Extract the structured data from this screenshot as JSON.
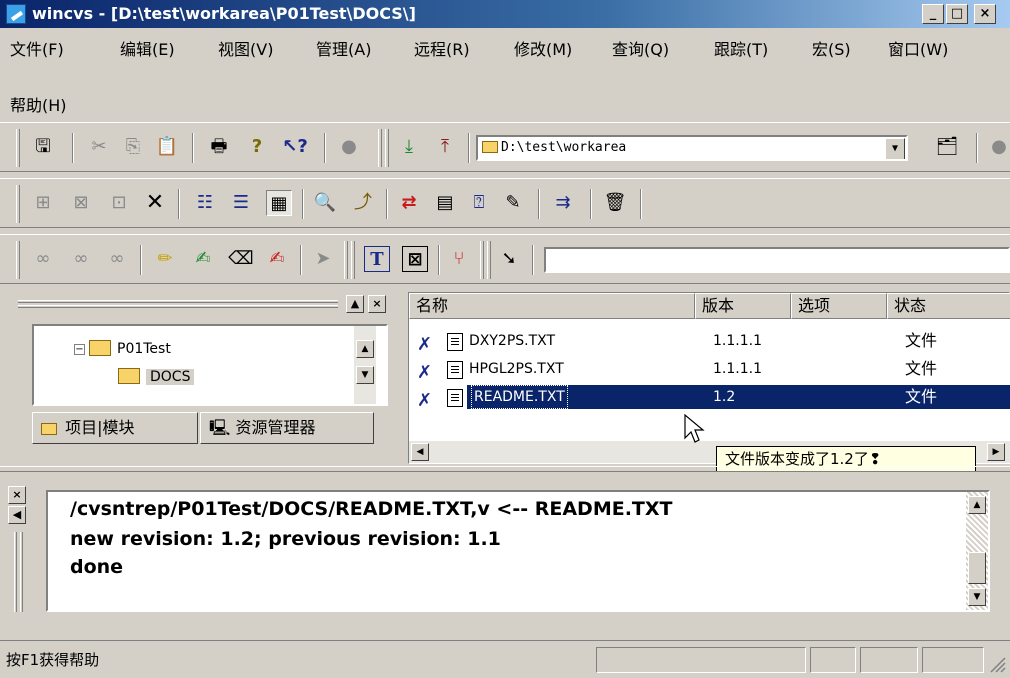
{
  "window": {
    "title": "wincvs - [D:\\test\\workarea\\P01Test\\DOCS\\]",
    "min_label": "_",
    "max_label": "□",
    "close_label": "×"
  },
  "menu": [
    {
      "label": "文件(F)"
    },
    {
      "label": "编辑(E)"
    },
    {
      "label": "视图(V)"
    },
    {
      "label": "管理(A)"
    },
    {
      "label": "远程(R)"
    },
    {
      "label": "修改(M)"
    },
    {
      "label": "查询(Q)"
    },
    {
      "label": "跟踪(T)"
    },
    {
      "label": "宏(S)"
    },
    {
      "label": "窗口(W)"
    },
    {
      "label": "帮助(H)"
    }
  ],
  "toolbar": {
    "path_value": "D:\\test\\workarea"
  },
  "tree": {
    "root_label": "P01Test",
    "child_label": "DOCS"
  },
  "tabs": {
    "modules_label": "项目|模块",
    "explorer_label": "资源管理器"
  },
  "columns": {
    "name": "名称",
    "revision": "版本",
    "option": "选项",
    "status": "状态"
  },
  "files": [
    {
      "name": "DXY2PS.TXT",
      "revision": "1.1.1.1",
      "option": "",
      "status": "文件",
      "selected": false
    },
    {
      "name": "HPGL2PS.TXT",
      "revision": "1.1.1.1",
      "option": "",
      "status": "文件",
      "selected": false
    },
    {
      "name": "README.TXT",
      "revision": "1.2",
      "option": "",
      "status": "文件",
      "selected": true
    }
  ],
  "tooltip": "文件版本变成了1.2了❢",
  "output": {
    "line1": "/cvsntrep/P01Test/DOCS/README.TXT,v  <--  README.TXT",
    "line2": "new revision: 1.2; previous revision: 1.1",
    "line3": "done"
  },
  "status": {
    "help_text": "按F1获得帮助"
  }
}
